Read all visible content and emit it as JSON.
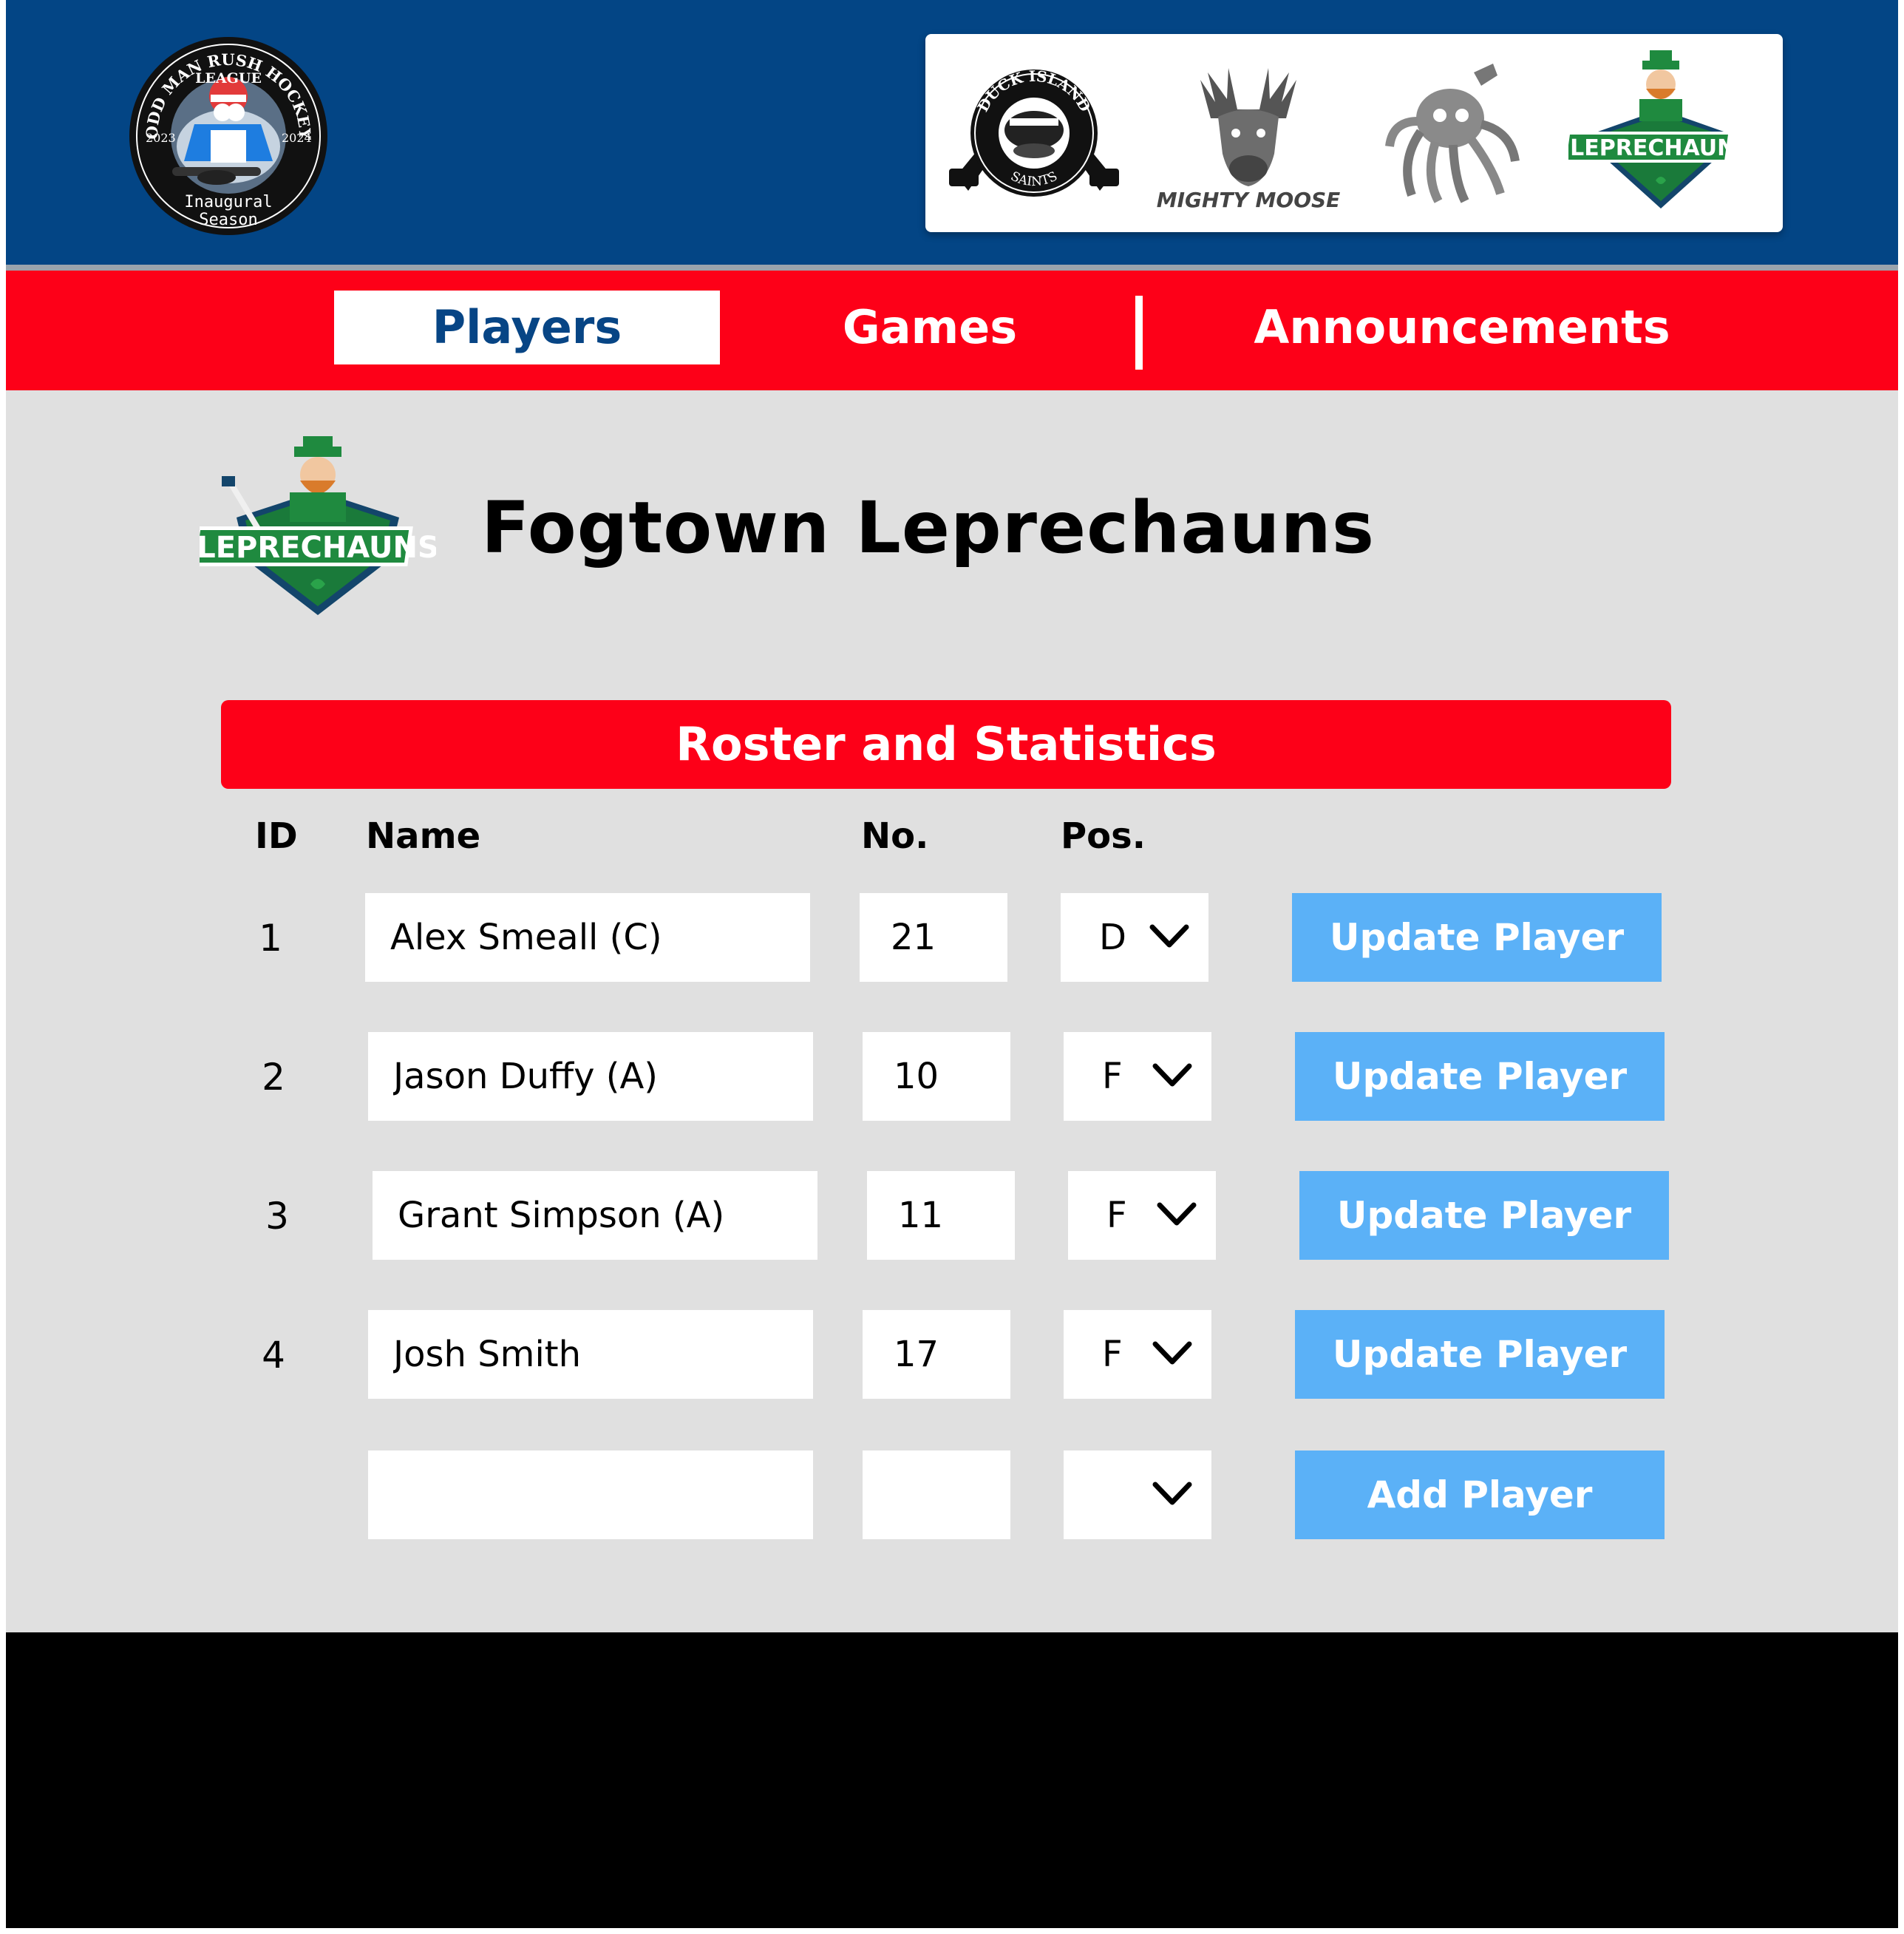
{
  "colors": {
    "header_blue": "#034585",
    "nav_red": "#fd0018",
    "content_gray": "#e0e0e0",
    "button_blue": "#5bb1f7",
    "active_tab_text": "#074585",
    "footer": "#000000"
  },
  "header": {
    "league_logo": {
      "top_text": "ODD MAN RUSH HOCKEY",
      "middle_text": "LEAGUE",
      "year_left": "2023",
      "year_right": "2024",
      "bottom_text_1": "Inaugural",
      "bottom_text_2": "Season"
    },
    "team_logos": [
      {
        "icon": "duck-island-saints-logo",
        "text_top": "DUCK ISLAND",
        "text_bottom": "SAINTS"
      },
      {
        "icon": "mighty-moose-logo",
        "text": "MIGHTY MOOSE"
      },
      {
        "icon": "octopus-logo"
      },
      {
        "icon": "leprechauns-logo",
        "text": "LEPRECHAUNS"
      }
    ]
  },
  "nav": {
    "tabs": [
      {
        "label": "Players",
        "active": true
      },
      {
        "label": "Games",
        "active": false
      },
      {
        "label": "Announcements",
        "active": false
      }
    ]
  },
  "team": {
    "name": "Fogtown Leprechauns",
    "logo_text": "LEPRECHAUNS"
  },
  "roster": {
    "title": "Roster and Statistics",
    "columns": [
      "ID",
      "Name",
      "No.",
      "Pos."
    ],
    "rows": [
      {
        "id": "1",
        "name": "Alex Smeall (C)",
        "number": "21",
        "position": "D",
        "button": "Update Player"
      },
      {
        "id": "2",
        "name": "Jason Duffy (A)",
        "number": "10",
        "position": "F",
        "button": "Update Player"
      },
      {
        "id": "3",
        "name": "Grant Simpson (A)",
        "number": "11",
        "position": "F",
        "button": "Update Player"
      },
      {
        "id": "4",
        "name": "Josh Smith",
        "number": "17",
        "position": "F",
        "button": "Update Player"
      }
    ],
    "new_row": {
      "name": "",
      "number": "",
      "position": "",
      "button": "Add Player"
    }
  }
}
